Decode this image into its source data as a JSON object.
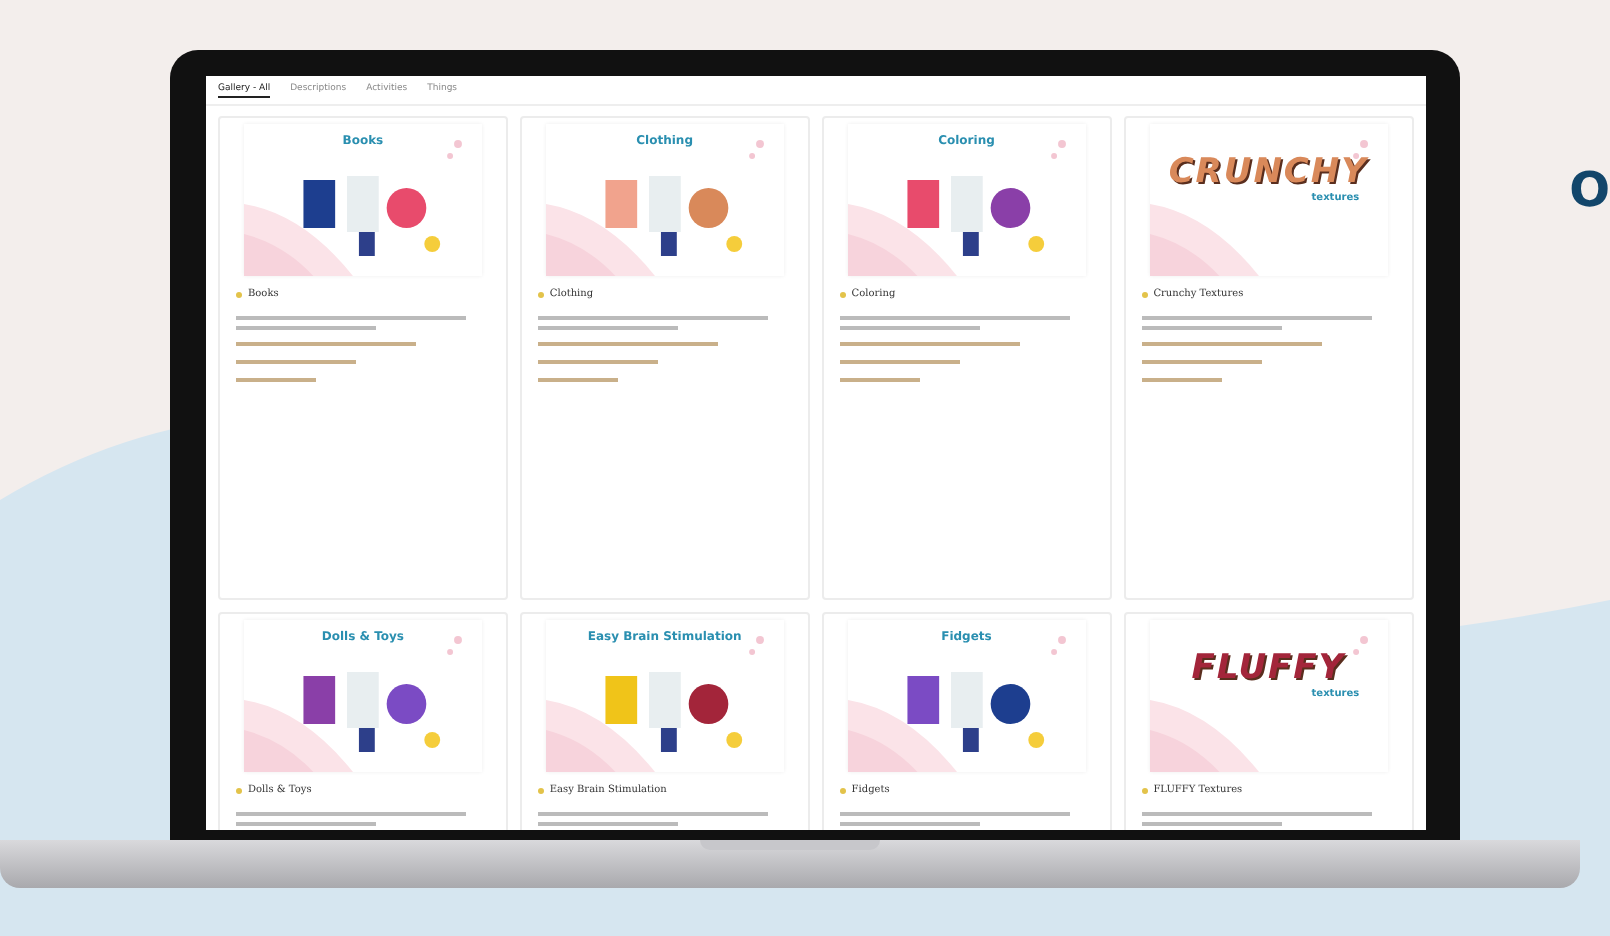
{
  "tabs": [
    {
      "label": "Gallery - All",
      "selected": true
    },
    {
      "label": "Descriptions",
      "selected": false
    },
    {
      "label": "Activities",
      "selected": false
    },
    {
      "label": "Things",
      "selected": false
    }
  ],
  "heading_fragment": "O",
  "cards": [
    {
      "cover_title": "Books",
      "kind": "illustration",
      "title": "Books"
    },
    {
      "cover_title": "Clothing",
      "kind": "illustration",
      "title": "Clothing"
    },
    {
      "cover_title": "Coloring",
      "kind": "illustration",
      "title": "Coloring"
    },
    {
      "cover_title": "CRUNCHY",
      "cover_subtitle": "textures",
      "kind": "wordmark",
      "title": "Crunchy Textures",
      "color": "#d9895a"
    },
    {
      "cover_title": "Dolls & Toys",
      "kind": "illustration",
      "title": "Dolls & Toys"
    },
    {
      "cover_title": "Easy Brain Stimulation",
      "kind": "illustration",
      "title": "Easy Brain Stimulation"
    },
    {
      "cover_title": "Fidgets",
      "kind": "illustration",
      "title": "Fidgets"
    },
    {
      "cover_title": "FLUFFY",
      "cover_subtitle": "textures",
      "kind": "wordmark",
      "title": "FLUFFY Textures",
      "color": "#a3253a"
    }
  ]
}
